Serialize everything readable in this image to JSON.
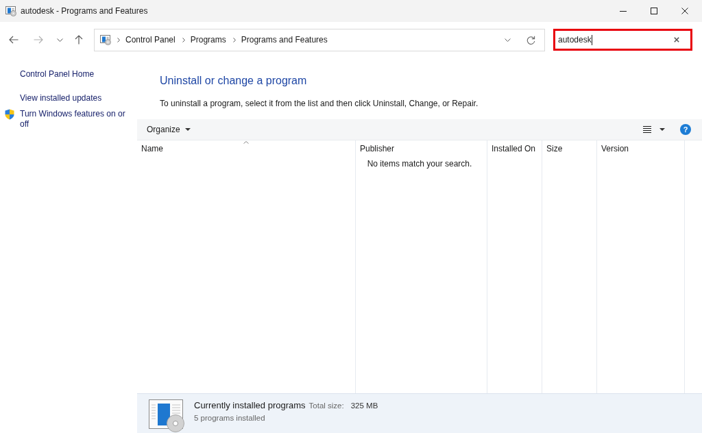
{
  "window": {
    "title": "autodesk - Programs and Features"
  },
  "navigation": [
    {
      "kind": "back",
      "disabled": false
    },
    {
      "kind": "forward",
      "disabled": true
    },
    {
      "kind": "recent",
      "disabled": false
    },
    {
      "kind": "up",
      "disabled": false
    }
  ],
  "address_bar": {
    "crumbs": [
      "Control Panel",
      "Programs",
      "Programs and Features"
    ]
  },
  "search": {
    "value": "autodesk"
  },
  "sidebar": {
    "items": [
      {
        "label": "Control Panel Home",
        "kind": "link"
      },
      {
        "label": "View installed updates",
        "kind": "link"
      },
      {
        "label": "Turn Windows features on or off",
        "kind": "admin_link"
      }
    ]
  },
  "content": {
    "heading": "Uninstall or change a program",
    "description": "To uninstall a program, select it from the list and then click Uninstall, Change, or Repair."
  },
  "toolbar": {
    "organize": "Organize",
    "help": "?"
  },
  "table": {
    "columns": [
      {
        "label": "Name",
        "sorted": true
      },
      {
        "label": "Publisher",
        "sorted": false
      },
      {
        "label": "Installed On",
        "sorted": false
      },
      {
        "label": "Size",
        "sorted": false
      },
      {
        "label": "Version",
        "sorted": false
      }
    ],
    "empty_message": "No items match your search."
  },
  "status_bar": {
    "title": "Currently installed programs",
    "total_size_label": "Total size:",
    "total_size": "325 MB",
    "count": "5 programs installed"
  }
}
